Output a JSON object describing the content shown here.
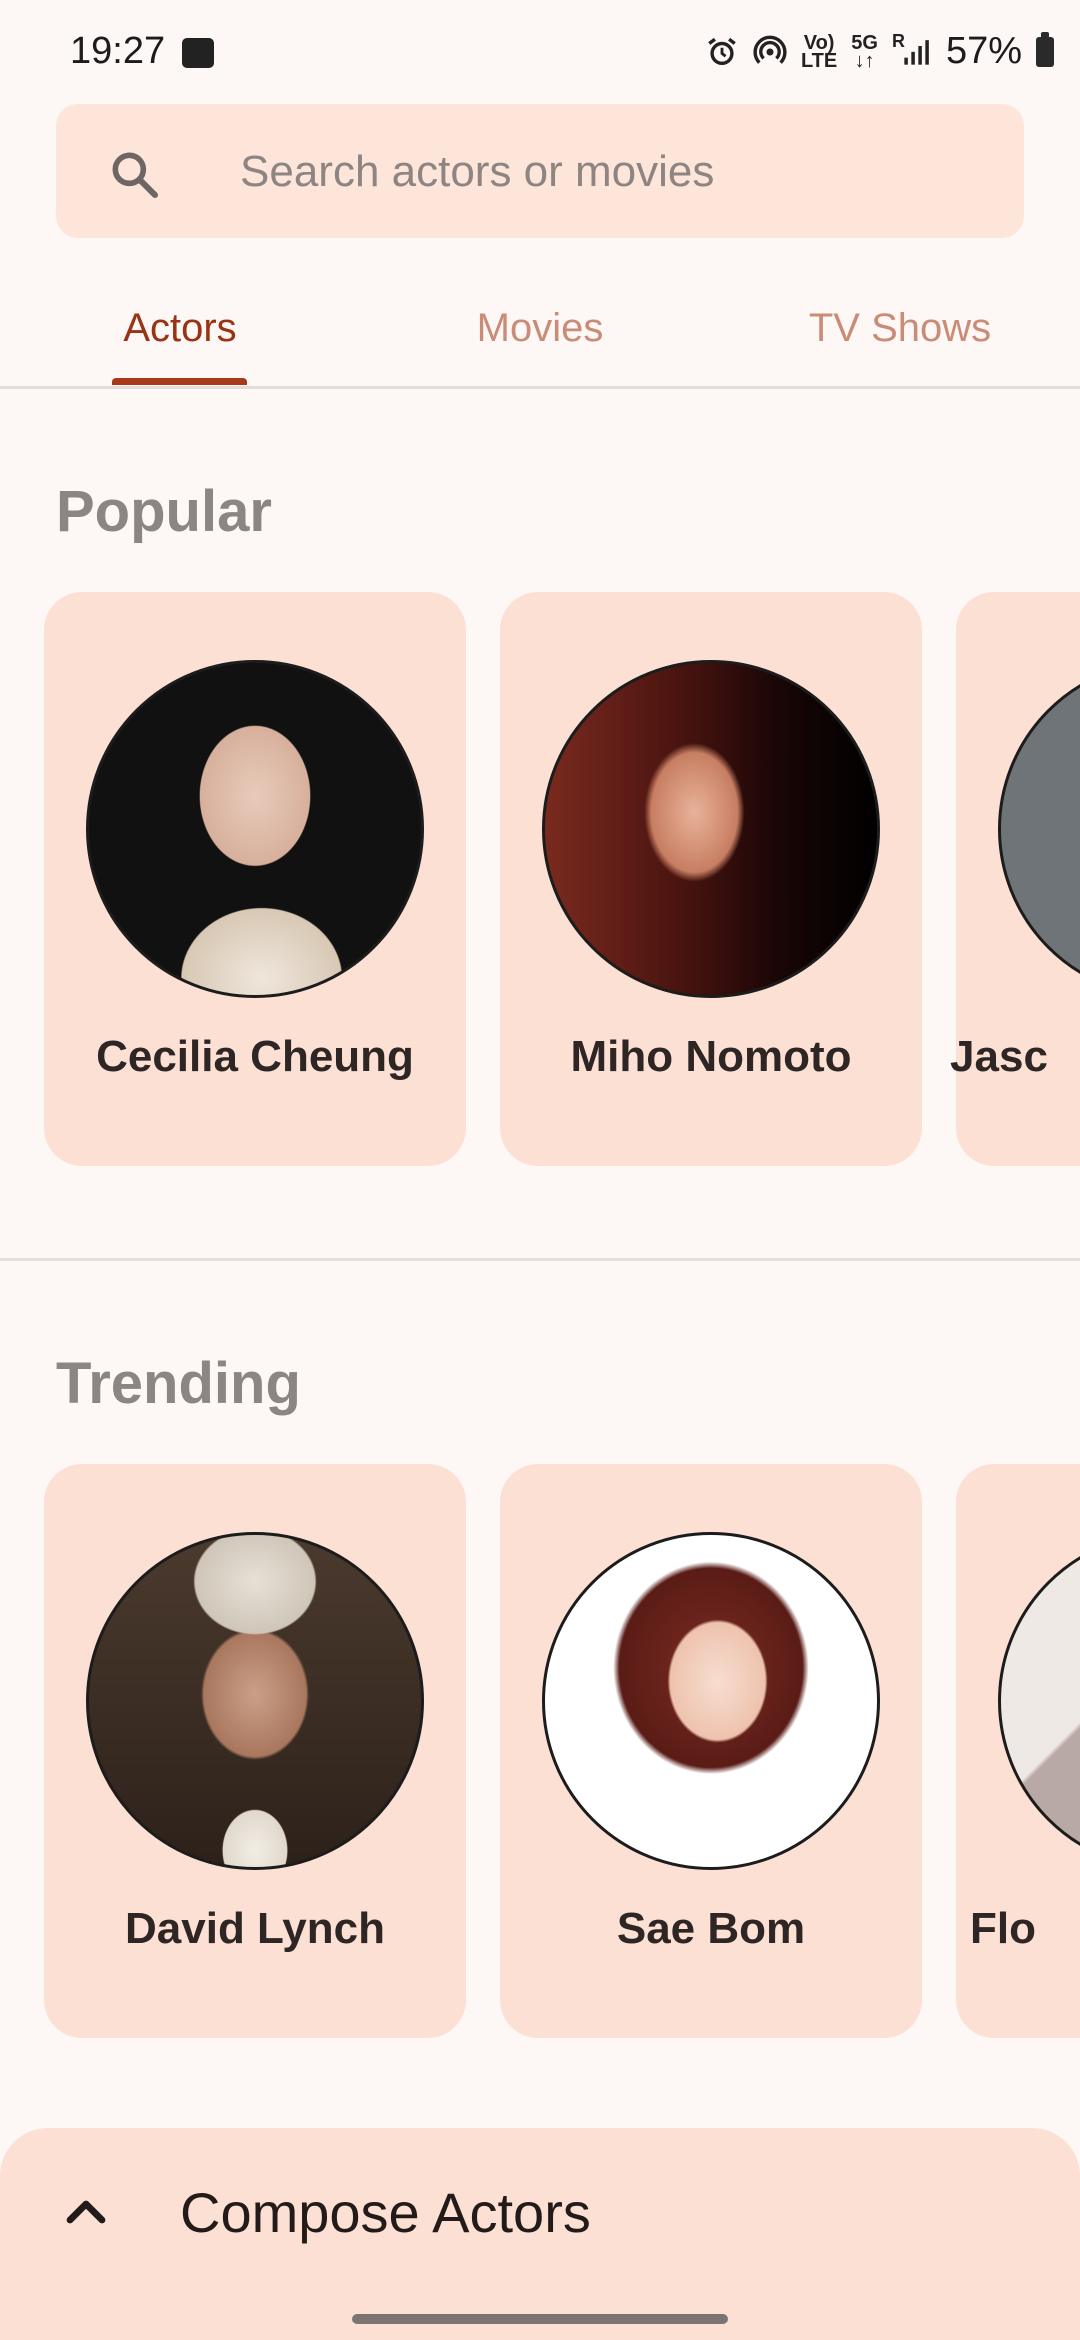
{
  "status_bar": {
    "time": "19:27",
    "network_top": "Vo)",
    "network_bottom": "LTE",
    "net_5g": "5G",
    "roaming": "R",
    "battery": "57%"
  },
  "search": {
    "placeholder": "Search actors or movies"
  },
  "tabs": [
    {
      "label": "Actors",
      "active": true
    },
    {
      "label": "Movies",
      "active": false
    },
    {
      "label": "TV Shows",
      "active": false
    }
  ],
  "sections": {
    "popular": {
      "title": "Popular",
      "items": [
        {
          "name": "Cecilia Cheung"
        },
        {
          "name": "Miho Nomoto"
        },
        {
          "name": "Jasc"
        }
      ]
    },
    "trending": {
      "title": "Trending",
      "items": [
        {
          "name": "David Lynch"
        },
        {
          "name": "Sae Bom"
        },
        {
          "name": "Flo"
        }
      ]
    }
  },
  "bottom_sheet": {
    "title": "Compose Actors"
  },
  "colors": {
    "accent": "#a8391a",
    "card": "#fde0d4",
    "search_bg": "#fde5da",
    "background": "#fdf7f6"
  }
}
